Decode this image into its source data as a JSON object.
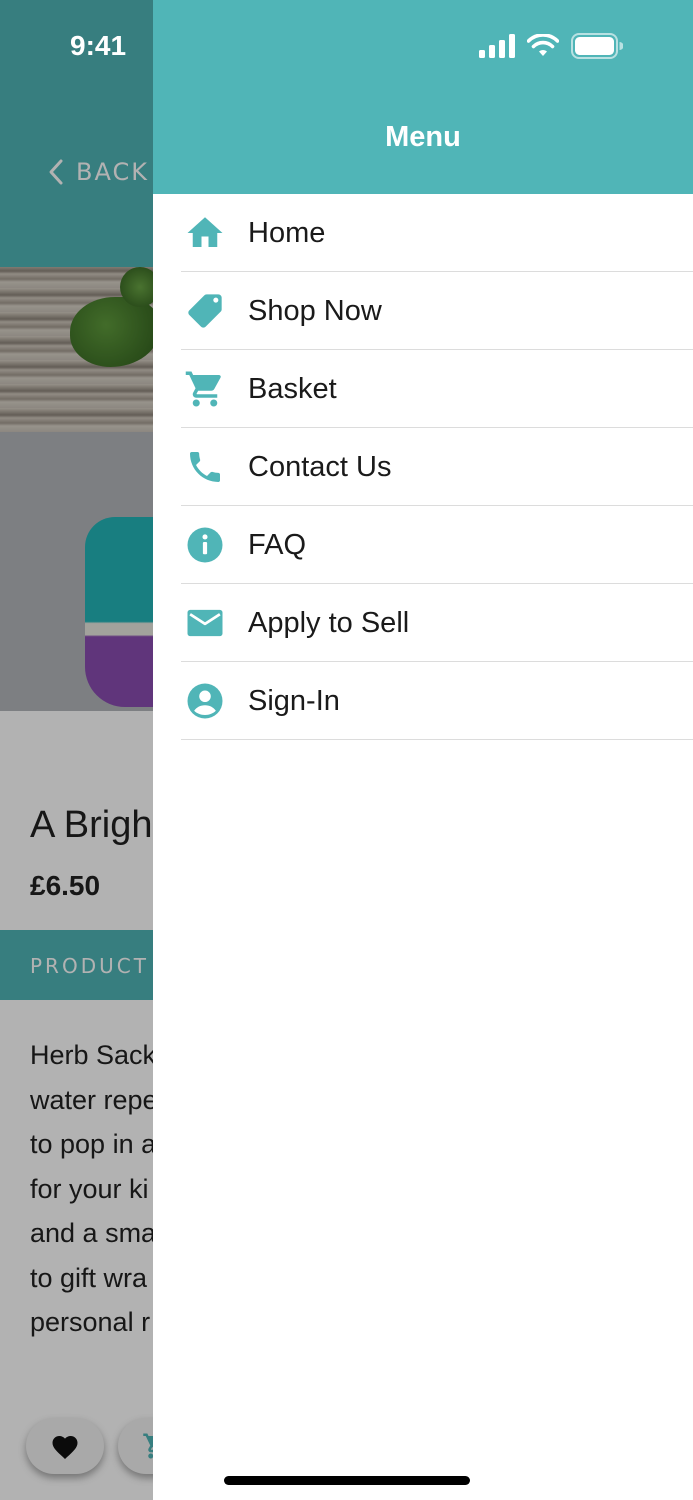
{
  "status_bar": {
    "time": "9:41"
  },
  "background_page": {
    "back_label": "BACK",
    "product_title": "A Brigh",
    "price": "£6.50",
    "section_label": "PRODUCT",
    "description_lines": "Herb Sack\nwater repe\nto pop in a\nfor your ki\nand a sma\nto gift wra\npersonal r"
  },
  "menu": {
    "title": "Menu",
    "items": [
      {
        "label": "Home",
        "icon": "home-icon"
      },
      {
        "label": "Shop Now",
        "icon": "tag-icon"
      },
      {
        "label": "Basket",
        "icon": "cart-icon"
      },
      {
        "label": "Contact Us",
        "icon": "phone-icon"
      },
      {
        "label": "FAQ",
        "icon": "info-icon"
      },
      {
        "label": "Apply to Sell",
        "icon": "mail-icon"
      },
      {
        "label": "Sign-In",
        "icon": "user-icon"
      }
    ]
  },
  "colors": {
    "accent": "#50b5b7",
    "overlay": "rgba(0,0,0,0.30)",
    "text": "#1a1a1a",
    "divider": "#dcdcdc"
  }
}
